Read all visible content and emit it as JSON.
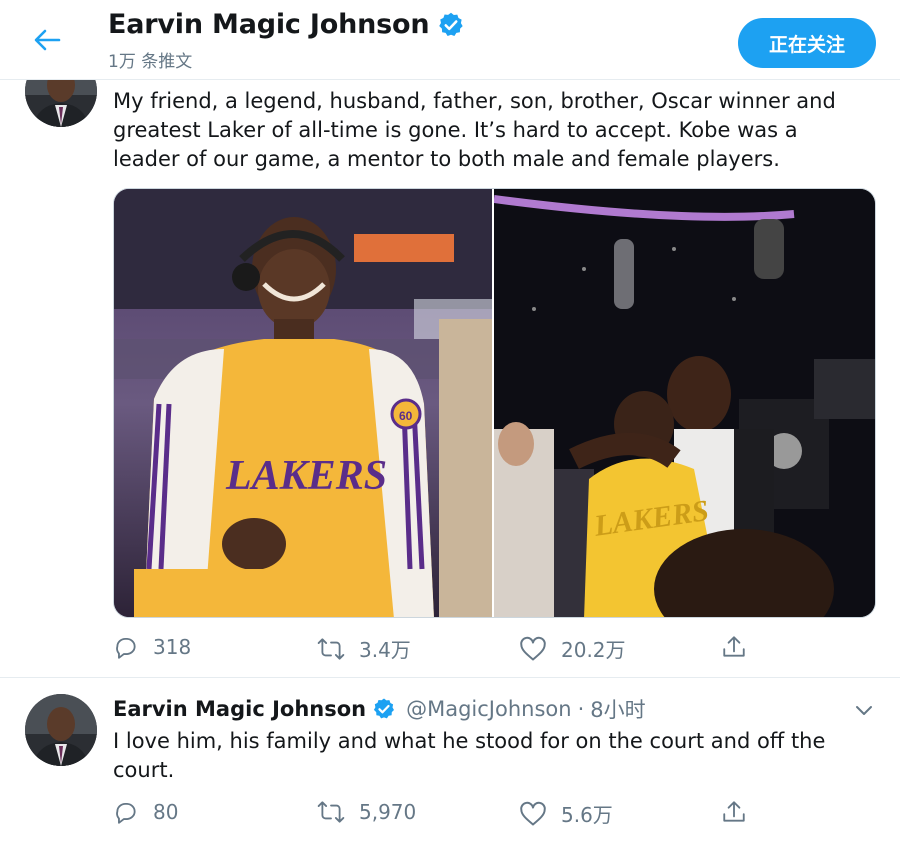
{
  "header": {
    "title": "Earvin Magic Johnson",
    "tweet_count": "1万 条推文",
    "follow_label": "正在关注"
  },
  "tweets": [
    {
      "text_lines": [
        "My friend, a legend, husband, father, son, brother, Oscar winner and",
        "greatest Laker of all-time is gone. It’s hard to accept. Kobe was a",
        "leader of our game, a mentor to both male and female players."
      ],
      "media": {
        "jersey_text": "LAKERS",
        "jersey_number": "60"
      },
      "replies": "318",
      "retweets": "3.4万",
      "likes": "20.2万"
    },
    {
      "author": "Earvin Magic Johnson",
      "handle": "@MagicJohnson",
      "dot": "·",
      "time": "8小时",
      "text_lines": [
        "I love him, his family and what he stood for on the court and off the",
        "court."
      ],
      "replies": "80",
      "retweets": "5,970",
      "likes": "5.6万"
    }
  ],
  "colors": {
    "accent": "#1da1f2",
    "text_secondary": "#657786",
    "border": "#e6ecf0"
  },
  "icons": [
    "back-arrow-icon",
    "verified-badge-icon",
    "reply-icon",
    "retweet-icon",
    "like-icon",
    "share-icon",
    "chevron-down-icon"
  ]
}
